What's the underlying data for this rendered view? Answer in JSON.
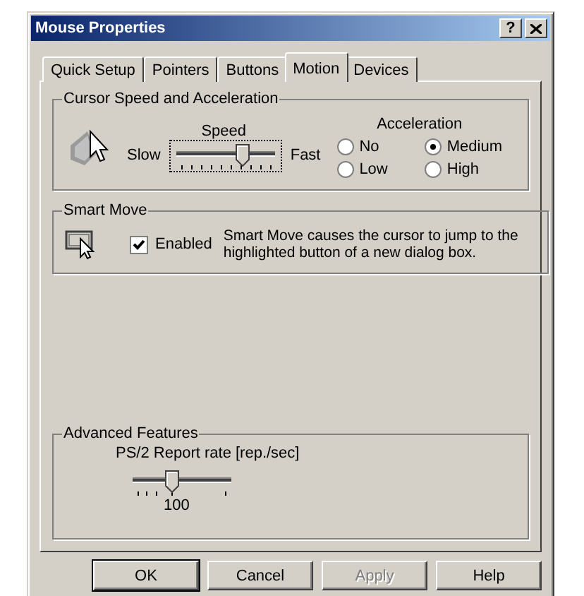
{
  "window": {
    "title": "Mouse Properties",
    "help_button": "?"
  },
  "tabs": [
    {
      "label": "Quick Setup",
      "selected": false
    },
    {
      "label": "Pointers",
      "selected": false
    },
    {
      "label": "Buttons",
      "selected": false
    },
    {
      "label": "Motion",
      "selected": true
    },
    {
      "label": "Devices",
      "selected": false
    }
  ],
  "cursor_speed": {
    "title": "Cursor Speed and Acceleration",
    "speed_label": "Speed",
    "slow_label": "Slow",
    "fast_label": "Fast",
    "speed": {
      "level": 0.67
    },
    "acceleration_label": "Acceleration",
    "acceleration_options": [
      {
        "label": "No",
        "selected": false
      },
      {
        "label": "Medium",
        "selected": true
      },
      {
        "label": "Low",
        "selected": false
      },
      {
        "label": "High",
        "selected": false
      }
    ]
  },
  "smart_move": {
    "title": "Smart Move",
    "enabled": {
      "label": "Enabled",
      "checked": true
    },
    "description": "Smart Move causes the cursor to jump to the highlighted button of a new dialog box."
  },
  "advanced": {
    "title": "Advanced Features",
    "rate_label": "PS/2 Report rate [rep./sec]",
    "rate": {
      "level": 0.4
    },
    "rate_value": "100"
  },
  "buttons": [
    {
      "label": "OK",
      "disabled": false,
      "default": true
    },
    {
      "label": "Cancel",
      "disabled": false,
      "default": false
    },
    {
      "label": "Apply",
      "disabled": true,
      "default": false
    },
    {
      "label": "Help",
      "disabled": false,
      "default": false
    }
  ]
}
